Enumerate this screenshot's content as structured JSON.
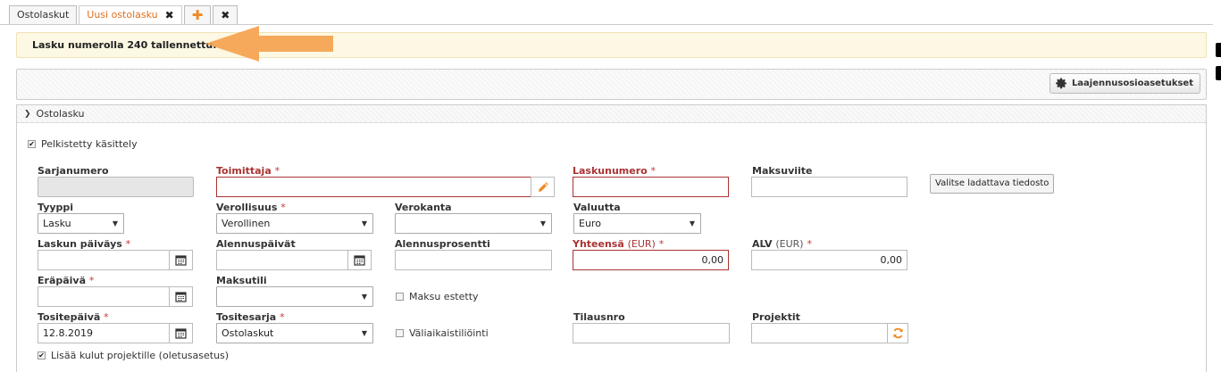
{
  "tabs": [
    {
      "label": "Ostolaskut"
    },
    {
      "label": "Uusi ostolasku"
    }
  ],
  "alert": {
    "message": "Lasku numerolla 240 tallennettu."
  },
  "toolbar": {
    "extensions_button": "Laajennusosioasetukset"
  },
  "panel": {
    "title": "Ostolasku"
  },
  "form": {
    "simplified": {
      "label": "Pelkistetty käsittely",
      "checked": true
    },
    "sarjanumero": {
      "label": "Sarjanumero",
      "value": ""
    },
    "toimittaja": {
      "label": "Toimittaja",
      "value": ""
    },
    "laskunumero": {
      "label": "Laskunumero",
      "value": ""
    },
    "maksuviite": {
      "label": "Maksuviite",
      "value": ""
    },
    "file_button": "Valitse ladattava tiedosto",
    "tyyppi": {
      "label": "Tyyppi",
      "value": "Lasku"
    },
    "verollisuus": {
      "label": "Verollisuus",
      "value": "Verollinen"
    },
    "verokanta": {
      "label": "Verokanta",
      "value": ""
    },
    "valuutta": {
      "label": "Valuutta",
      "value": "Euro"
    },
    "laskun_paivays": {
      "label": "Laskun päiväys",
      "value": ""
    },
    "alennuspaivat": {
      "label": "Alennuspäivät",
      "value": ""
    },
    "alennusprosentti": {
      "label": "Alennusprosentti",
      "value": ""
    },
    "yhteensa": {
      "label": "Yhteensä",
      "unit": "(EUR)",
      "value": "0,00"
    },
    "alv": {
      "label": "ALV",
      "unit": "(EUR)",
      "value": "0,00"
    },
    "erapaiva": {
      "label": "Eräpäivä",
      "value": ""
    },
    "maksutili": {
      "label": "Maksutili",
      "value": ""
    },
    "maksu_estetty": {
      "label": "Maksu estetty",
      "checked": false
    },
    "tositepaiva": {
      "label": "Tositepäivä",
      "value": "12.8.2019"
    },
    "tositesarja": {
      "label": "Tositesarja",
      "value": "Ostolaskut"
    },
    "valiaikaistilointi": {
      "label": "Väliaikaistiliöinti",
      "checked": false
    },
    "tilausnro": {
      "label": "Tilausnro",
      "value": ""
    },
    "projektit": {
      "label": "Projektit",
      "value": ""
    },
    "lisaa_kulut": {
      "label": "Lisää kulut projektille (oletusasetus)",
      "checked": true
    }
  },
  "required_marker": "*",
  "colors": {
    "accent": "#e0701e",
    "required": "#a33333",
    "alert_bg": "#fcf8e3",
    "arrow": "#f5a04a"
  },
  "icons": [
    "close-icon",
    "plus-icon",
    "gear-icon",
    "chevron-down-icon",
    "pencil-icon",
    "calendar-icon",
    "refresh-icon",
    "arrow-pointer"
  ]
}
